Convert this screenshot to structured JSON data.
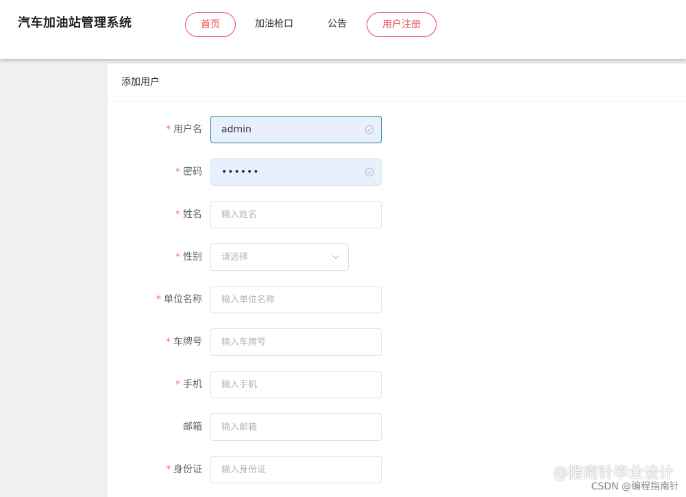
{
  "header": {
    "app_title": "汽车加油站管理系统",
    "nav": [
      {
        "label": "首页",
        "style": "pill"
      },
      {
        "label": "加油枪口",
        "style": "plain"
      },
      {
        "label": "公告",
        "style": "plain"
      },
      {
        "label": "用户注册",
        "style": "pill"
      }
    ]
  },
  "card": {
    "title": "添加用户"
  },
  "form": {
    "fields": [
      {
        "label": "用户名",
        "required": true,
        "value": "admin",
        "placeholder": ""
      },
      {
        "label": "密码",
        "required": true,
        "value": "••••••",
        "placeholder": ""
      },
      {
        "label": "姓名",
        "required": true,
        "value": "",
        "placeholder": "输入姓名"
      },
      {
        "label": "性别",
        "required": true,
        "value": "",
        "placeholder": "请选择"
      },
      {
        "label": "单位名称",
        "required": true,
        "value": "",
        "placeholder": "输入单位名称"
      },
      {
        "label": "车牌号",
        "required": true,
        "value": "",
        "placeholder": "输入车牌号"
      },
      {
        "label": "手机",
        "required": true,
        "value": "",
        "placeholder": "输入手机"
      },
      {
        "label": "邮箱",
        "required": false,
        "value": "",
        "placeholder": "输入邮箱"
      },
      {
        "label": "身份证",
        "required": true,
        "value": "",
        "placeholder": "输入身份证"
      }
    ]
  },
  "watermark": {
    "line1": "@指南针毕业设计",
    "line2": "CSDN @编程指南针"
  },
  "colors": {
    "accent_red": "#e5484d",
    "required_star": "#f56c6c",
    "autofill_bg": "#e8f0fe",
    "focus_border": "#1f8a85"
  }
}
